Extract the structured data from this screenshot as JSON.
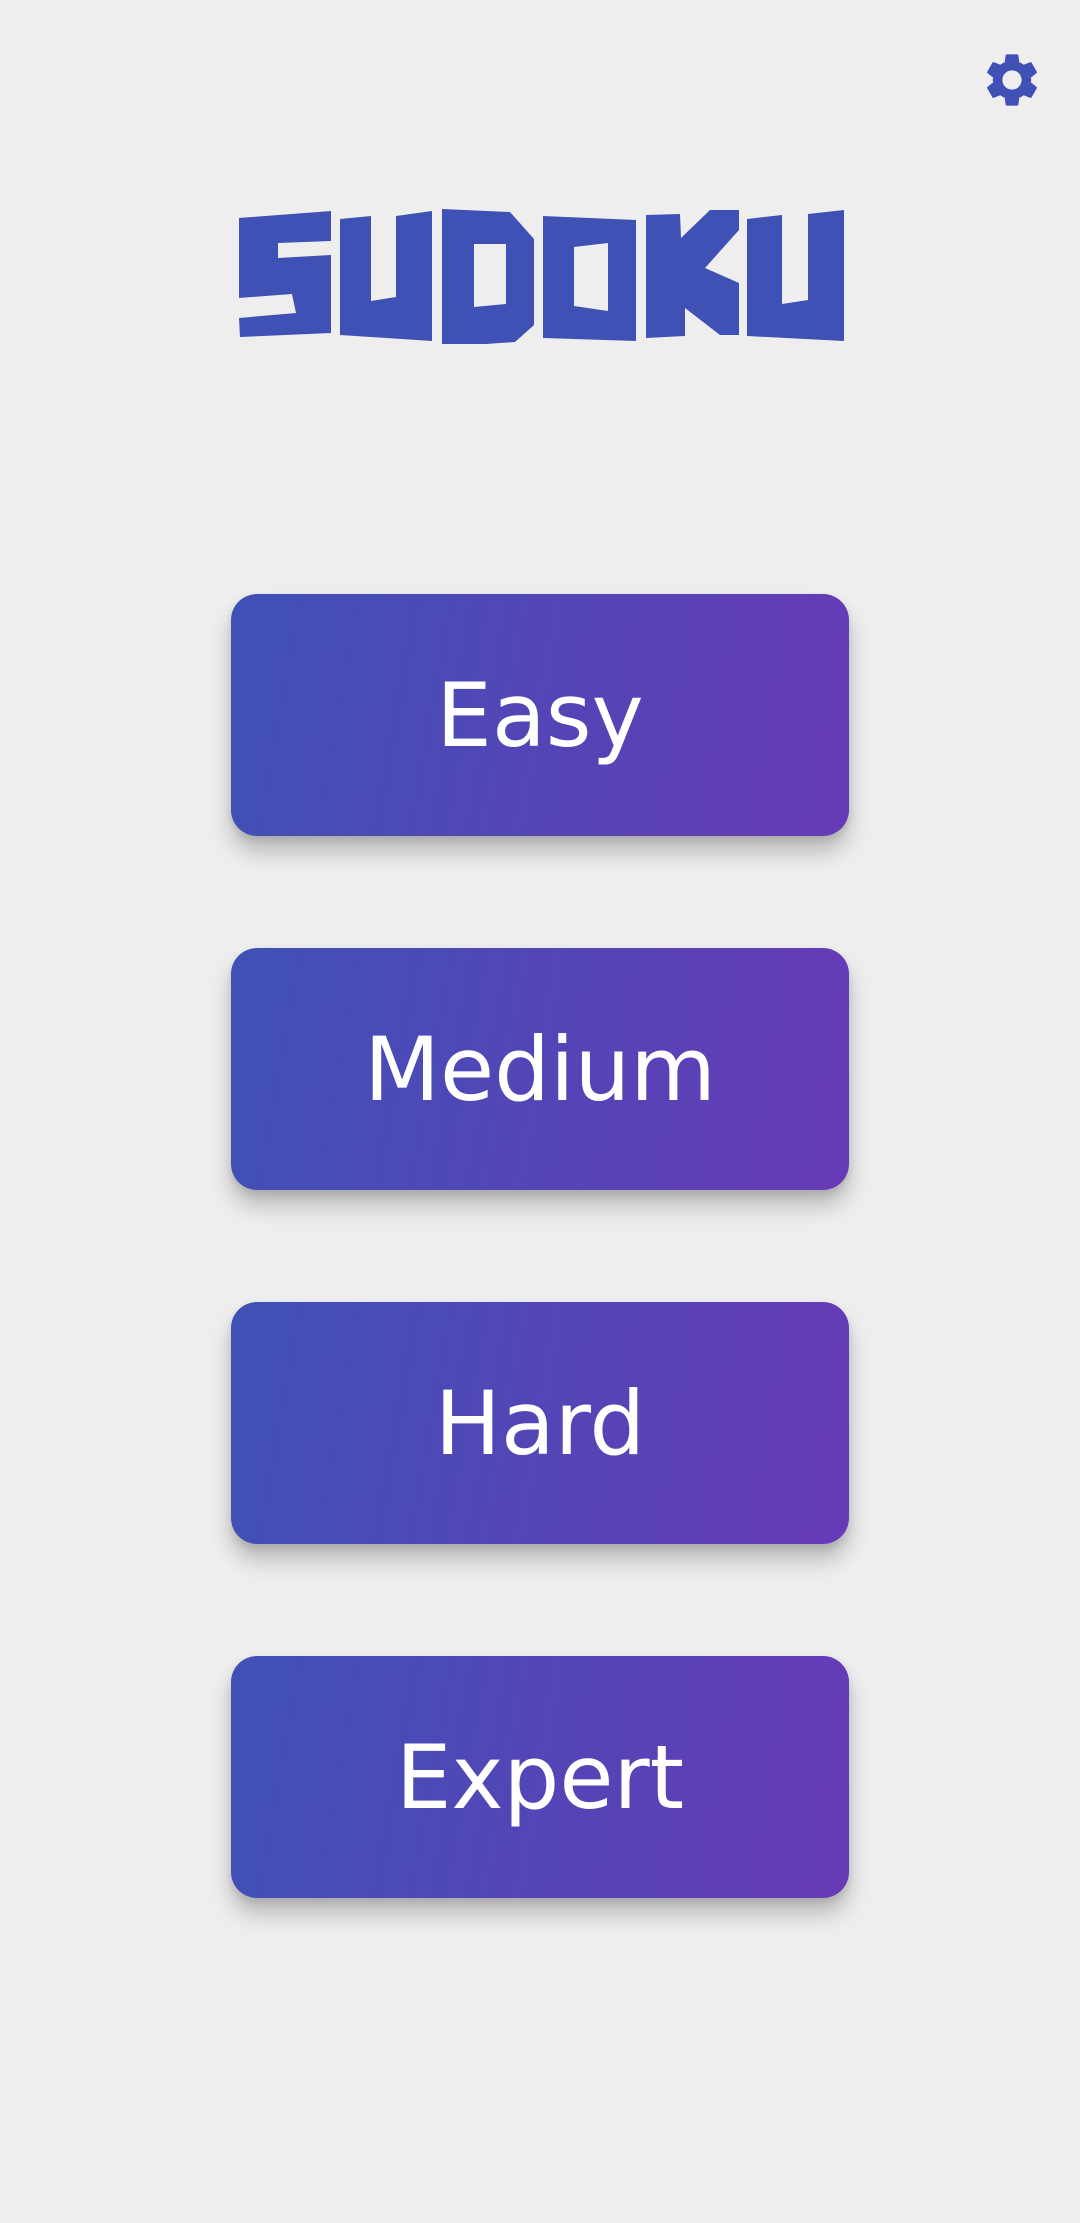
{
  "app": {
    "logo_text": "SUDOKU",
    "brand_color": "#3f51b5",
    "button_gradient_start": "#3f51b5",
    "button_gradient_end": "#673ab7",
    "background_color": "#eeeeee"
  },
  "header": {
    "settings_icon": "gear-icon"
  },
  "difficulties": [
    {
      "label": "Easy"
    },
    {
      "label": "Medium"
    },
    {
      "label": "Hard"
    },
    {
      "label": "Expert"
    }
  ]
}
